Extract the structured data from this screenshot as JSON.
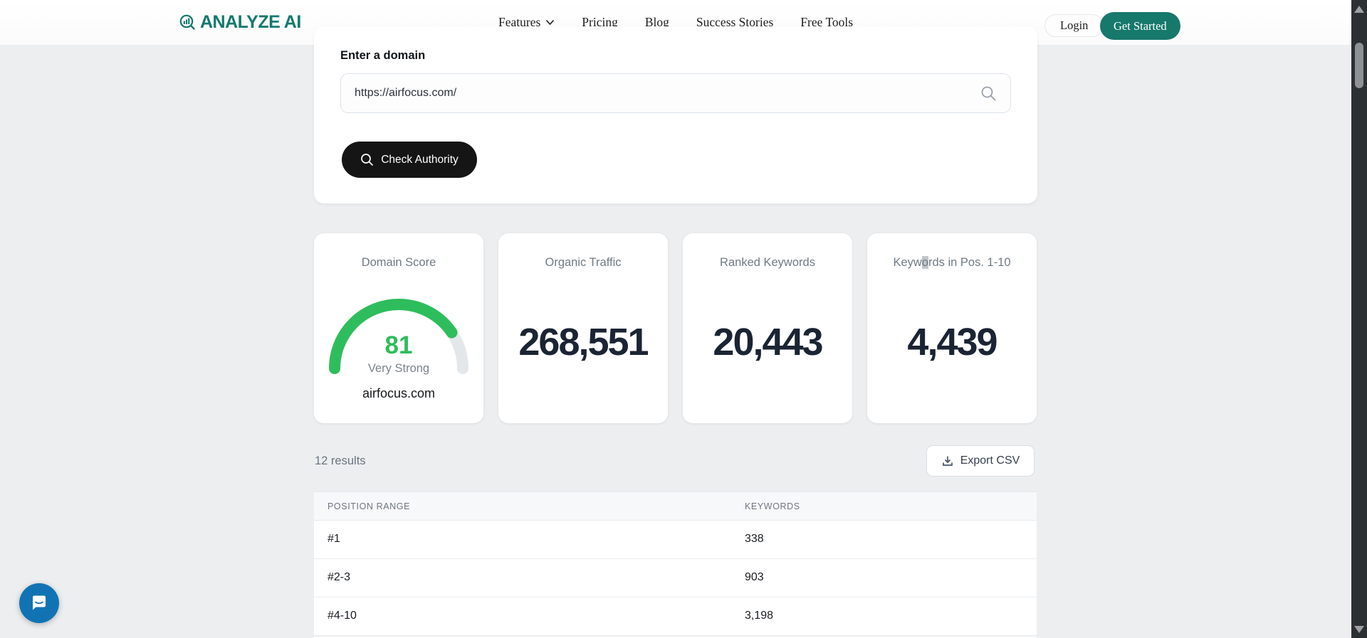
{
  "header": {
    "logo": "ANALYZE AI",
    "nav": [
      {
        "label": "Features",
        "has_dropdown": true
      },
      {
        "label": "Pricing",
        "has_dropdown": false
      },
      {
        "label": "Blog",
        "has_dropdown": false
      },
      {
        "label": "Success Stories",
        "has_dropdown": false
      },
      {
        "label": "Free Tools",
        "has_dropdown": false
      }
    ],
    "login_label": "Login",
    "get_started_label": "Get Started"
  },
  "search_card": {
    "label": "Enter a domain",
    "input_value": "https://airfocus.com/",
    "button_label": "Check Authority"
  },
  "metrics": {
    "domain_score": {
      "label": "Domain Score",
      "score": "81",
      "rating": "Very Strong",
      "domain": "airfocus.com",
      "gauge_percent": 81
    },
    "organic_traffic": {
      "label": "Organic Traffic",
      "value": "268,551"
    },
    "ranked_keywords": {
      "label": "Ranked Keywords",
      "value": "20,443"
    },
    "keywords_pos": {
      "label_prefix": "Keyw",
      "label_highlight": "o",
      "label_suffix": "rds in Pos. 1-10",
      "label_full": "Keywords in Pos. 1-10",
      "value": "4,439"
    }
  },
  "results": {
    "count_text": "12 results",
    "export_label": "Export CSV"
  },
  "table": {
    "columns": [
      "POSITION RANGE",
      "KEYWORDS"
    ],
    "rows": [
      {
        "range": "#1",
        "keywords": "338"
      },
      {
        "range": "#2-3",
        "keywords": "903"
      },
      {
        "range": "#4-10",
        "keywords": "3,198"
      }
    ]
  },
  "colors": {
    "brand_teal": "#14796d",
    "gauge_green": "#2ebd5c",
    "gauge_track": "#e4e7ea",
    "number_navy": "#1b2433",
    "button_black": "#151515",
    "chat_blue": "#1273b4",
    "page_bg": "#eceef0"
  }
}
